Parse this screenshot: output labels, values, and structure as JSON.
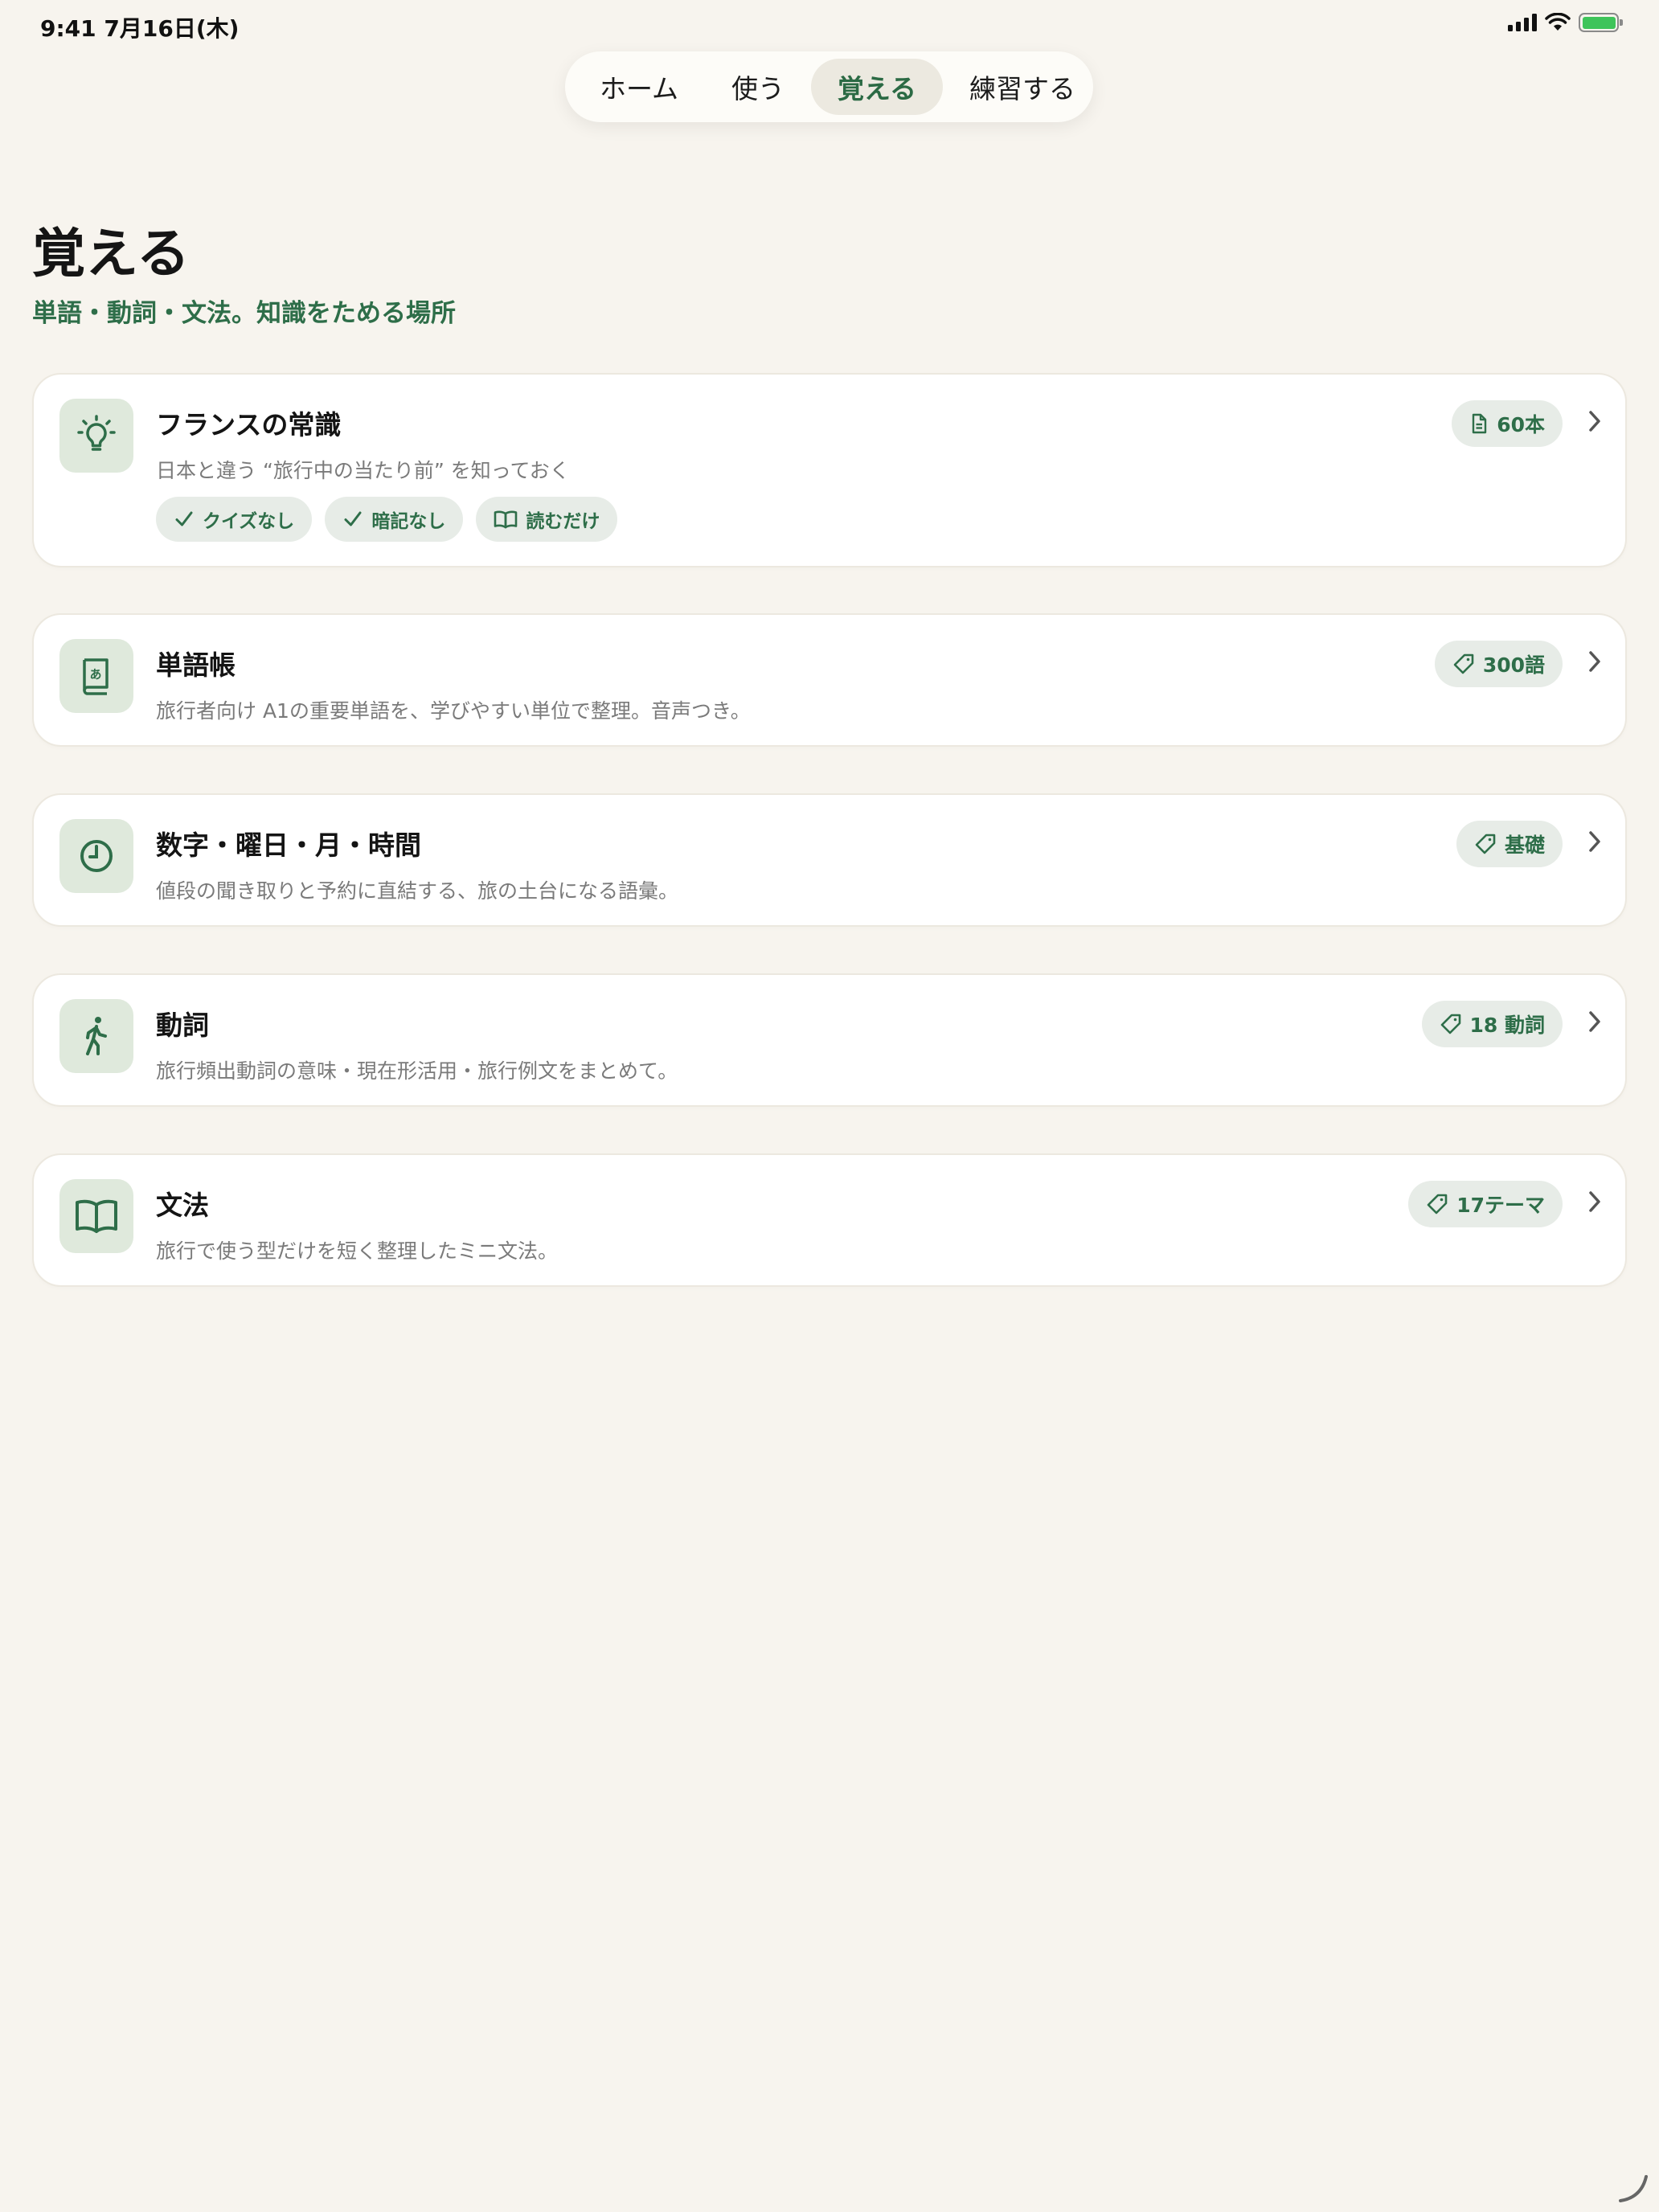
{
  "status_bar": {
    "time": "9:41  7月16日(木)",
    "icons": [
      "cellular-signal-icon",
      "wifi-icon",
      "battery-charging-icon"
    ],
    "battery_color": "#3ec45a"
  },
  "nav": {
    "tabs": [
      {
        "label": "ホーム",
        "active": false
      },
      {
        "label": "使う",
        "active": false
      },
      {
        "label": "覚える",
        "active": true
      },
      {
        "label": "練習する",
        "active": false
      }
    ]
  },
  "page": {
    "title": "覚える",
    "subtitle": "単語・動詞・文法。知識をためる場所"
  },
  "colors": {
    "background": "#f7f4ee",
    "accent_green": "#2e6e49",
    "icon_tile": "#dfe9dc",
    "badge_bg": "#e7ece7"
  },
  "cards": [
    {
      "title": "フランスの常識",
      "description": "日本と違う “旅行中の当たり前” を知っておく",
      "icon": "lightbulb-icon",
      "badge": {
        "icon": "document-icon",
        "label": "60本"
      },
      "chips": [
        {
          "icon": "checkmark-icon",
          "label": "クイズなし"
        },
        {
          "icon": "checkmark-icon",
          "label": "暗記なし"
        },
        {
          "icon": "book-open-icon",
          "label": "読むだけ"
        }
      ]
    },
    {
      "title": "単語帳",
      "description": "旅行者向け A1の重要単語を、学びやすい単位で整理。音声つき。",
      "icon": "vocabulary-book-icon",
      "badge": {
        "icon": "tag-icon",
        "label": "300語"
      }
    },
    {
      "title": "数字・曜日・月・時間",
      "description": "値段の聞き取りと予約に直結する、旅の土台になる語彙。",
      "icon": "clock-icon",
      "badge": {
        "icon": "tag-icon",
        "label": "基礎"
      }
    },
    {
      "title": "動詞",
      "description": "旅行頻出動詞の意味・現在形活用・旅行例文をまとめて。",
      "icon": "walking-person-icon",
      "badge": {
        "icon": "tag-icon",
        "label": "18 動詞"
      }
    },
    {
      "title": "文法",
      "description": "旅行で使う型だけを短く整理したミニ文法。",
      "icon": "book-open-icon",
      "badge": {
        "icon": "tag-icon",
        "label": "17テーマ"
      }
    }
  ]
}
